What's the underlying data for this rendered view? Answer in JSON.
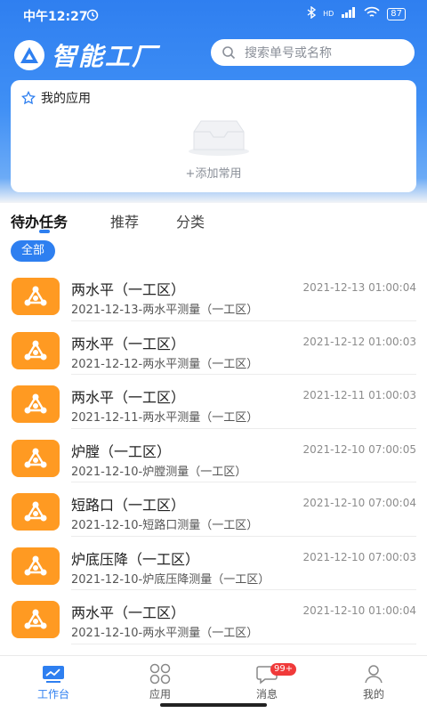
{
  "status": {
    "time": "中午12:27",
    "battery": "87",
    "signal": "HD"
  },
  "header": {
    "app_title": "智能工厂",
    "search_placeholder": "搜索单号或名称"
  },
  "my_apps": {
    "title": "我的应用",
    "add_label": "+添加常用"
  },
  "tabs": [
    {
      "label": "待办任务"
    },
    {
      "label": "推荐"
    },
    {
      "label": "分类"
    }
  ],
  "filter_chip": "全部",
  "tasks": [
    {
      "title": "两水平（一工区）",
      "time": "2021-12-13 01:00:04",
      "subtitle": "2021-12-13-两水平测量（一工区）"
    },
    {
      "title": "两水平（一工区）",
      "time": "2021-12-12 01:00:03",
      "subtitle": "2021-12-12-两水平测量（一工区）"
    },
    {
      "title": "两水平（一工区）",
      "time": "2021-12-11 01:00:03",
      "subtitle": "2021-12-11-两水平测量（一工区）"
    },
    {
      "title": "炉膛（一工区）",
      "time": "2021-12-10 07:00:05",
      "subtitle": "2021-12-10-炉膛测量（一工区）"
    },
    {
      "title": "短路口（一工区）",
      "time": "2021-12-10 07:00:04",
      "subtitle": "2021-12-10-短路口测量（一工区）"
    },
    {
      "title": "炉底压降（一工区）",
      "time": "2021-12-10 07:00:03",
      "subtitle": "2021-12-10-炉底压降测量（一工区）"
    },
    {
      "title": "两水平（一工区）",
      "time": "2021-12-10 01:00:04",
      "subtitle": "2021-12-10-两水平测量（一工区）"
    }
  ],
  "tabbar": {
    "workbench": "工作台",
    "apps": "应用",
    "messages": "消息",
    "messages_badge": "99+",
    "mine": "我的"
  },
  "colors": {
    "primary": "#2e7ff0",
    "task_icon": "#ff9a22",
    "badge": "#f03a3a"
  }
}
